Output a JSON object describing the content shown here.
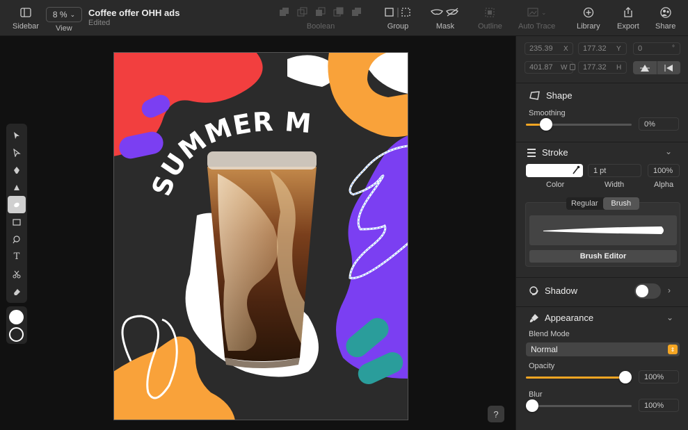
{
  "toolbar": {
    "sidebar_label": "Sidebar",
    "zoom_value": "8 %",
    "view_label": "View",
    "doc_title": "Coffee offer OHH ads",
    "doc_status": "Edited",
    "boolean_label": "Boolean",
    "group_label": "Group",
    "mask_label": "Mask",
    "outline_label": "Outline",
    "autotrace_label": "Auto Trace",
    "library_label": "Library",
    "export_label": "Export",
    "share_label": "Share"
  },
  "artboard": {
    "headline": "SUMMER MENU"
  },
  "help": {
    "label": "?"
  },
  "panel": {
    "geometry": {
      "x_value": "235.39",
      "x_label": "X",
      "y_value": "177.32",
      "y_label": "Y",
      "rotation_value": "0",
      "rotation_unit": "°",
      "w_value": "401.87",
      "w_label": "W",
      "h_value": "177.32",
      "h_label": "H"
    },
    "shape": {
      "title": "Shape",
      "smoothing_label": "Smoothing",
      "smoothing_value": "0%",
      "smoothing_level": 0.0
    },
    "stroke": {
      "title": "Stroke",
      "color_label": "Color",
      "width_value": "1 pt",
      "width_label": "Width",
      "alpha_value": "100%",
      "alpha_label": "Alpha",
      "color_hex": "#ffffff",
      "tabs": [
        "Regular",
        "Brush"
      ],
      "active_tab": "Brush",
      "brush_editor_label": "Brush Editor"
    },
    "shadow": {
      "title": "Shadow",
      "enabled": false
    },
    "appearance": {
      "title": "Appearance",
      "blend_label": "Blend Mode",
      "blend_value": "Normal",
      "opacity_label": "Opacity",
      "opacity_value": "100%",
      "opacity_level": 1.0,
      "blur_label": "Blur",
      "blur_value": "100%",
      "blur_level": 0.0
    }
  },
  "colors": {
    "accent": "#f5a623",
    "red": "#f23f3f",
    "purple": "#7b3ff2",
    "orange": "#f9a23a",
    "teal": "#2a9d9b",
    "selection": "#6aa0ff"
  }
}
